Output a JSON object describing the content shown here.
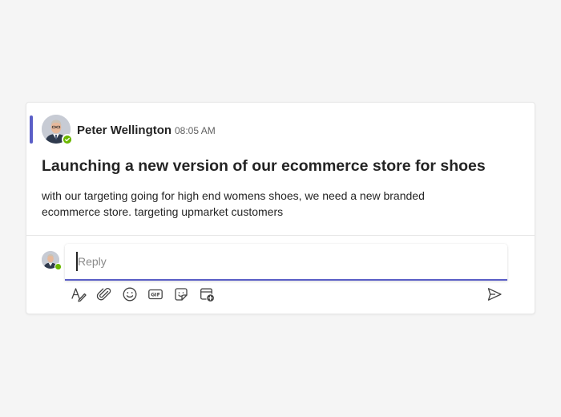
{
  "colors": {
    "accent": "#5b5fc7",
    "presence_available": "#6bb700",
    "icon": "#424242",
    "text_primary": "#242424",
    "text_secondary": "#616161"
  },
  "post": {
    "author": "Peter Wellington",
    "timestamp": "08:05 AM",
    "avatar_icon": "user-avatar",
    "presence_icon": "presence-available-icon",
    "subject": "Launching a new version of our ecommerce store for shoes",
    "body": "with our targeting going for high end womens shoes, we need a new branded ecommerce store. targeting upmarket customers"
  },
  "reply": {
    "placeholder": "Reply",
    "toolbar_icons": [
      "format-icon",
      "attach-icon",
      "emoji-icon",
      "gif-icon",
      "sticker-icon",
      "schedule-meeting-icon"
    ],
    "send_icon": "send-icon"
  }
}
